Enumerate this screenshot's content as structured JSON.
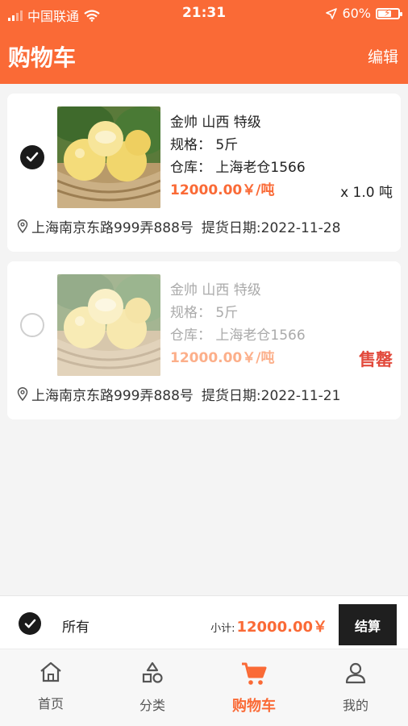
{
  "status_bar": {
    "carrier": "中国联通",
    "time": "21:31",
    "battery": "60%",
    "battery_level": 0.6
  },
  "header": {
    "title": "购物车",
    "edit_label": "编辑"
  },
  "cart_items": [
    {
      "title": "金帅 山西 特级",
      "spec": "规格： 5斤",
      "warehouse": "仓库： 上海老仓1566",
      "price": "12000.00￥/吨",
      "quantity": "x 1.0 吨",
      "address": "上海南京东路999弄888号",
      "pickup_date": "提货日期:2022-11-28",
      "checked": true
    },
    {
      "title": "金帅 山西 特级",
      "spec": "规格： 5斤",
      "warehouse": "仓库： 上海老仓1566",
      "price": "12000.00￥/吨",
      "status": "售罄",
      "address": "上海南京东路999弄888号",
      "pickup_date": "提货日期:2022-11-21",
      "checked": false
    }
  ],
  "footer": {
    "select_all_label": "所有",
    "subtotal_label": "小计:",
    "subtotal_value": "12000.00￥",
    "checkout_label": "结算"
  },
  "tabbar": [
    {
      "label": "首页",
      "icon": "home-icon"
    },
    {
      "label": "分类",
      "icon": "category-icon"
    },
    {
      "label": "购物车",
      "icon": "cart-icon",
      "active": true
    },
    {
      "label": "我的",
      "icon": "user-icon"
    }
  ],
  "colors": {
    "accent": "#fa6a36",
    "sold_out": "#e24a3c",
    "checkout_bg": "#1f1f1f"
  }
}
